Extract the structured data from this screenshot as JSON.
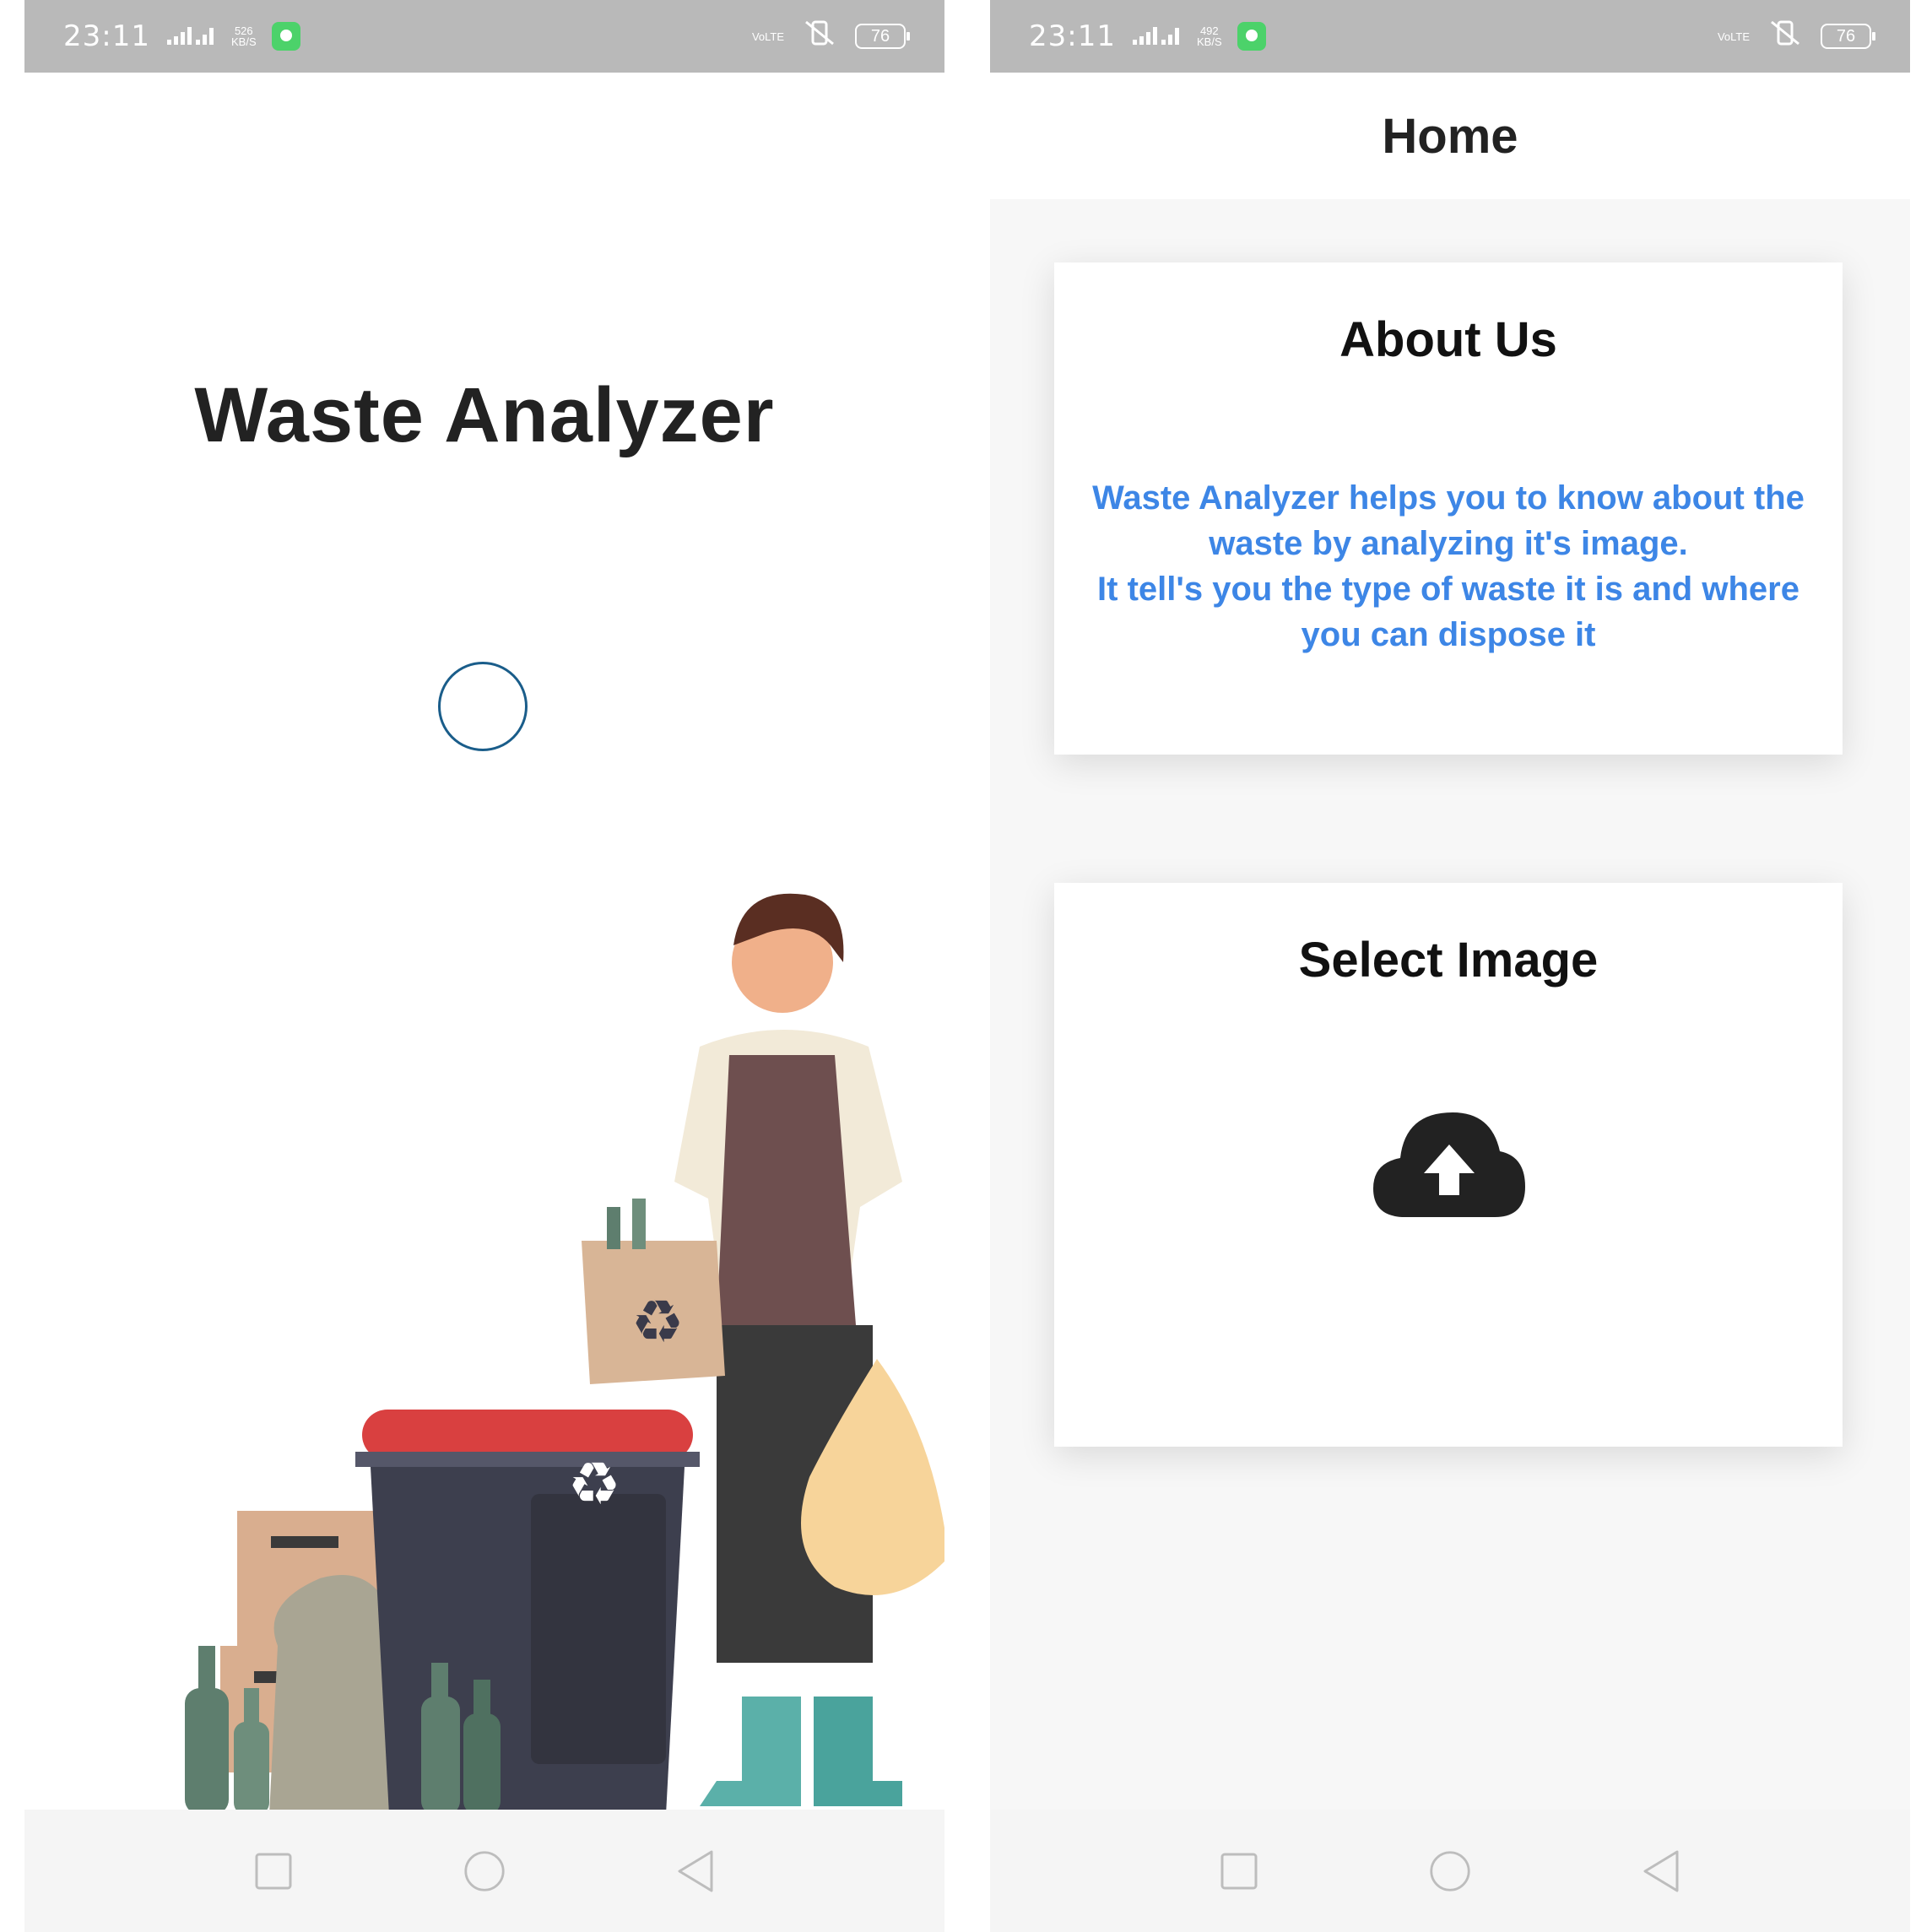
{
  "status_bar": {
    "time": "23:11",
    "net_speed_left": "526\nKB/S",
    "net_speed_right": "492\nKB/S",
    "volte": "VoLTE",
    "battery": "76"
  },
  "splash": {
    "title": "Waste Analyzer"
  },
  "home": {
    "header_title": "Home",
    "about": {
      "title": "About Us",
      "text_line1": "Waste Analyzer helps you to know about the waste by analyzing it's image.",
      "text_line2": "It tell's you the type of waste it is and where you can dispose it"
    },
    "select": {
      "title": "Select Image"
    }
  },
  "icons": {
    "upload": "cloud-upload-icon",
    "nav_recent": "square-icon",
    "nav_home": "circle-icon",
    "nav_back": "triangle-back-icon"
  },
  "colors": {
    "status_bar": "#b9b9b9",
    "about_text": "#3d86e6",
    "title_text": "#222222",
    "bin_lid": "#d94040",
    "bin_body": "#3d3f4e"
  }
}
